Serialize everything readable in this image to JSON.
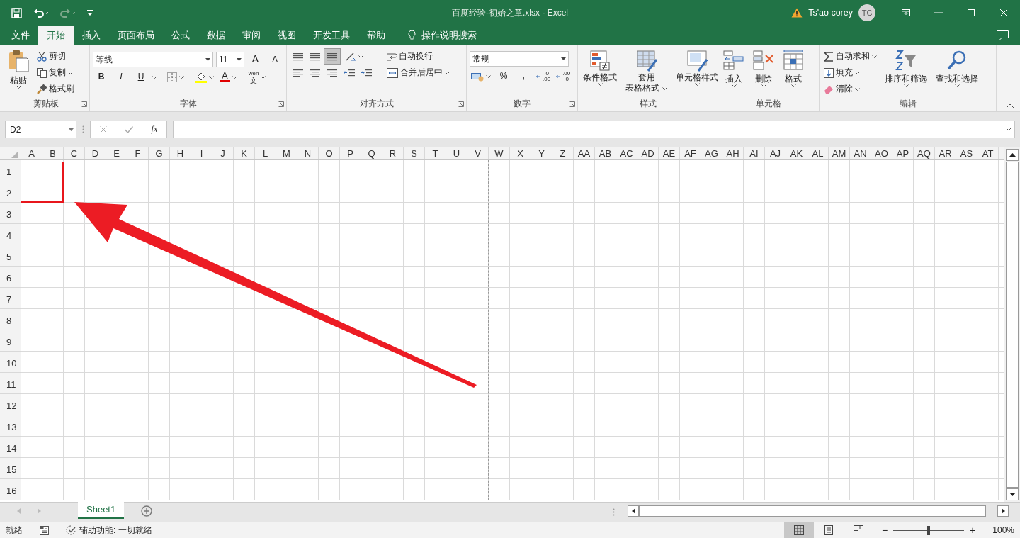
{
  "window": {
    "title": "百度经验-初始之章.xlsx  -  Excel",
    "user": "Ts'ao corey",
    "avatar": "TC"
  },
  "tabs": [
    {
      "label": "文件",
      "selected": false
    },
    {
      "label": "开始",
      "selected": true
    },
    {
      "label": "插入",
      "selected": false
    },
    {
      "label": "页面布局",
      "selected": false
    },
    {
      "label": "公式",
      "selected": false
    },
    {
      "label": "数据",
      "selected": false
    },
    {
      "label": "审阅",
      "selected": false
    },
    {
      "label": "视图",
      "selected": false
    },
    {
      "label": "开发工具",
      "selected": false
    },
    {
      "label": "帮助",
      "selected": false
    }
  ],
  "tell_me": "操作说明搜索",
  "ribbon": {
    "clipboard": {
      "label": "剪贴板",
      "paste": "粘贴",
      "cut": "剪切",
      "copy": "复制",
      "format_painter": "格式刷"
    },
    "font": {
      "label": "字体",
      "font_name": "等线",
      "font_size": "11",
      "grow": "A",
      "shrink": "A",
      "bold": "B",
      "italic": "I",
      "underline": "U",
      "font_color": "A",
      "phonetic": "wén",
      "phonetic_char": "文"
    },
    "alignment": {
      "label": "对齐方式",
      "wrap_text": "自动换行",
      "merge_center": "合并后居中"
    },
    "number": {
      "label": "数字",
      "format": "常规",
      "percent": "%",
      "comma": ",",
      "increase_decimal": [
        ".0",
        ".00"
      ],
      "decrease_decimal": [
        ".00",
        ".0"
      ]
    },
    "styles": {
      "label": "样式",
      "buttons": [
        {
          "lines": [
            "条件格式"
          ]
        },
        {
          "lines": [
            "套用",
            "表格格式"
          ]
        },
        {
          "lines": [
            "单元格样式"
          ]
        }
      ]
    },
    "cells": {
      "label": "单元格",
      "buttons": [
        "插入",
        "删除",
        "格式"
      ]
    },
    "editing": {
      "label": "编辑",
      "small": [
        "自动求和",
        "填充",
        "清除"
      ],
      "large": [
        "排序和筛选",
        "查找和选择"
      ]
    }
  },
  "formula_bar": {
    "name_box": "D2",
    "function": "fx"
  },
  "sheet": {
    "columns": [
      "A",
      "B",
      "C",
      "D",
      "E",
      "F",
      "G",
      "H",
      "I",
      "J",
      "K",
      "L",
      "M",
      "N",
      "O",
      "P",
      "Q",
      "R",
      "S",
      "T",
      "U",
      "V",
      "W",
      "X",
      "Y",
      "Z",
      "AA",
      "AB",
      "AC",
      "AD",
      "AE",
      "AF",
      "AG",
      "AH",
      "AI",
      "AJ",
      "AK",
      "AL",
      "AM",
      "AN",
      "AO",
      "AP",
      "AQ",
      "AR",
      "AS",
      "AT"
    ],
    "rows": [
      "1",
      "2",
      "3",
      "4",
      "5",
      "6",
      "7",
      "8",
      "9",
      "10",
      "11",
      "12",
      "13",
      "14",
      "15",
      "16"
    ]
  },
  "sheet_tabs": [
    {
      "label": "Sheet1",
      "selected": true
    }
  ],
  "status_bar": {
    "ready": "就绪",
    "accessibility": "辅助功能: 一切就绪",
    "views": [
      {
        "kind": "normal",
        "selected": true
      },
      {
        "kind": "page_layout",
        "selected": false
      },
      {
        "kind": "page_break",
        "selected": false
      }
    ],
    "zoom": {
      "minus": "−",
      "plus": "+",
      "level": 0.5,
      "reading": "100%"
    }
  }
}
